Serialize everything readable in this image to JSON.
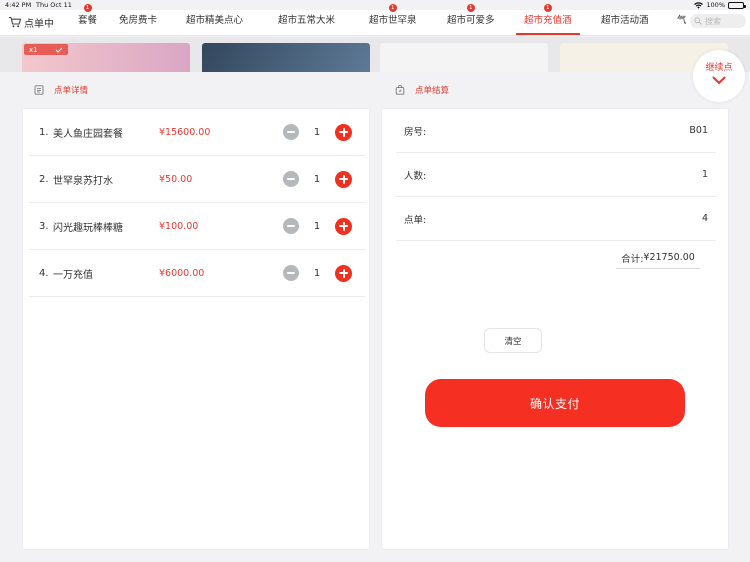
{
  "status_bar": {
    "time": "4:42 PM",
    "date": "Thu Oct 11",
    "battery": "100%"
  },
  "tabs": {
    "cart_label": "点单中",
    "items": [
      {
        "label": "套餐",
        "badge": "1"
      },
      {
        "label": "免房费卡",
        "badge": ""
      },
      {
        "label": "超市精美点心",
        "badge": ""
      },
      {
        "label": "超市五常大米",
        "badge": ""
      },
      {
        "label": "超市世罕泉",
        "badge": "1"
      },
      {
        "label": "超市可爱多",
        "badge": "1"
      },
      {
        "label": "超市充值酒",
        "badge": "1"
      },
      {
        "label": "超市活动酒",
        "badge": ""
      },
      {
        "label": "气",
        "badge": ""
      }
    ],
    "active_index": 6,
    "search_placeholder": "搜索"
  },
  "product_strip": {
    "qty_tag": "x1"
  },
  "continue_button": {
    "label": "继续点"
  },
  "order_detail": {
    "title": "点单详情",
    "items": [
      {
        "index": "1.",
        "name": "美人鱼庄园套餐",
        "price": "¥15600.00",
        "qty": "1"
      },
      {
        "index": "2.",
        "name": "世罕泉苏打水",
        "price": "¥50.00",
        "qty": "1"
      },
      {
        "index": "3.",
        "name": "闪光趣玩棒棒糖",
        "price": "¥100.00",
        "qty": "1"
      },
      {
        "index": "4.",
        "name": "一万充值",
        "price": "¥6000.00",
        "qty": "1"
      }
    ]
  },
  "checkout": {
    "title": "点单结算",
    "room_label": "房号:",
    "room_value": "B01",
    "people_label": "人数:",
    "people_value": "1",
    "orders_label": "点单:",
    "orders_value": "4",
    "total_label": "合计:",
    "total_value": "¥21750.00",
    "clear_label": "清空",
    "pay_label": "确认支付"
  },
  "colors": {
    "accent": "#e53a30",
    "pay_button": "#f52f22",
    "minus_button": "#b5b8bb"
  }
}
